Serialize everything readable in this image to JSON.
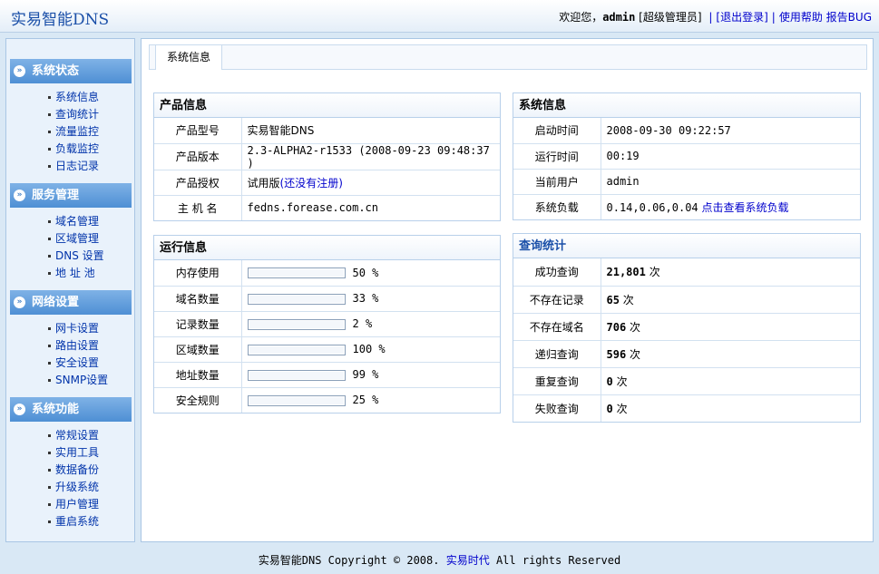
{
  "header": {
    "logo": "实易智能DNS",
    "welcome": "欢迎您，",
    "user": "admin",
    "role": "[超级管理员]",
    "sep": "|",
    "logout": "[退出登录]",
    "help": "使用帮助",
    "report": "报告BUG"
  },
  "sidebar": {
    "groups": [
      {
        "title": "系统状态",
        "items": [
          "系统信息",
          "查询统计",
          "流量监控",
          "负载监控",
          "日志记录"
        ]
      },
      {
        "title": "服务管理",
        "items": [
          "域名管理",
          "区域管理",
          "DNS 设置",
          "地 址 池"
        ]
      },
      {
        "title": "网络设置",
        "items": [
          "网卡设置",
          "路由设置",
          "安全设置",
          "SNMP设置"
        ]
      },
      {
        "title": "系统功能",
        "items": [
          "常规设置",
          "实用工具",
          "数据备份",
          "升级系统",
          "用户管理",
          "重启系统"
        ]
      }
    ]
  },
  "main": {
    "tab": "系统信息",
    "product": {
      "title": "产品信息",
      "rows": [
        {
          "k": "产品型号",
          "v": "实易智能DNS"
        },
        {
          "k": "产品版本",
          "v": "2.3-ALPHA2-r1533 (2008-09-23 09:48:37 )"
        },
        {
          "k": "产品授权",
          "v": "试用版",
          "link": "(还没有注册)"
        },
        {
          "k": "主 机 名",
          "v": "fedns.forease.com.cn"
        }
      ]
    },
    "sysinfo": {
      "title": "系统信息",
      "rows": [
        {
          "k": "启动时间",
          "v": "2008-09-30 09:22:57"
        },
        {
          "k": "运行时间",
          "v": "00:19"
        },
        {
          "k": "当前用户",
          "v": "admin"
        },
        {
          "k": "系统负载",
          "v": "0.14,0.06,0.04",
          "link": "点击查看系统负载"
        }
      ]
    },
    "runinfo": {
      "title": "运行信息",
      "rows": [
        {
          "k": "内存使用",
          "pct": 50,
          "label": "50 %"
        },
        {
          "k": "域名数量",
          "pct": 33,
          "label": "33 %"
        },
        {
          "k": "记录数量",
          "pct": 2,
          "label": "2 %"
        },
        {
          "k": "区域数量",
          "pct": 100,
          "label": "100 %"
        },
        {
          "k": "地址数量",
          "pct": 99,
          "label": "99 %"
        },
        {
          "k": "安全规则",
          "pct": 25,
          "label": "25 %"
        }
      ]
    },
    "querystats": {
      "title": "查询统计",
      "unit": "次",
      "rows": [
        {
          "k": "成功查询",
          "v": "21,801"
        },
        {
          "k": "不存在记录",
          "v": "65"
        },
        {
          "k": "不存在域名",
          "v": "706"
        },
        {
          "k": "递归查询",
          "v": "596"
        },
        {
          "k": "重复查询",
          "v": "0"
        },
        {
          "k": "失败查询",
          "v": "0"
        }
      ]
    }
  },
  "footer": {
    "prefix": "实易智能DNS Copyright © 2008. ",
    "company": "实易时代",
    "suffix": " All rights Reserved"
  }
}
